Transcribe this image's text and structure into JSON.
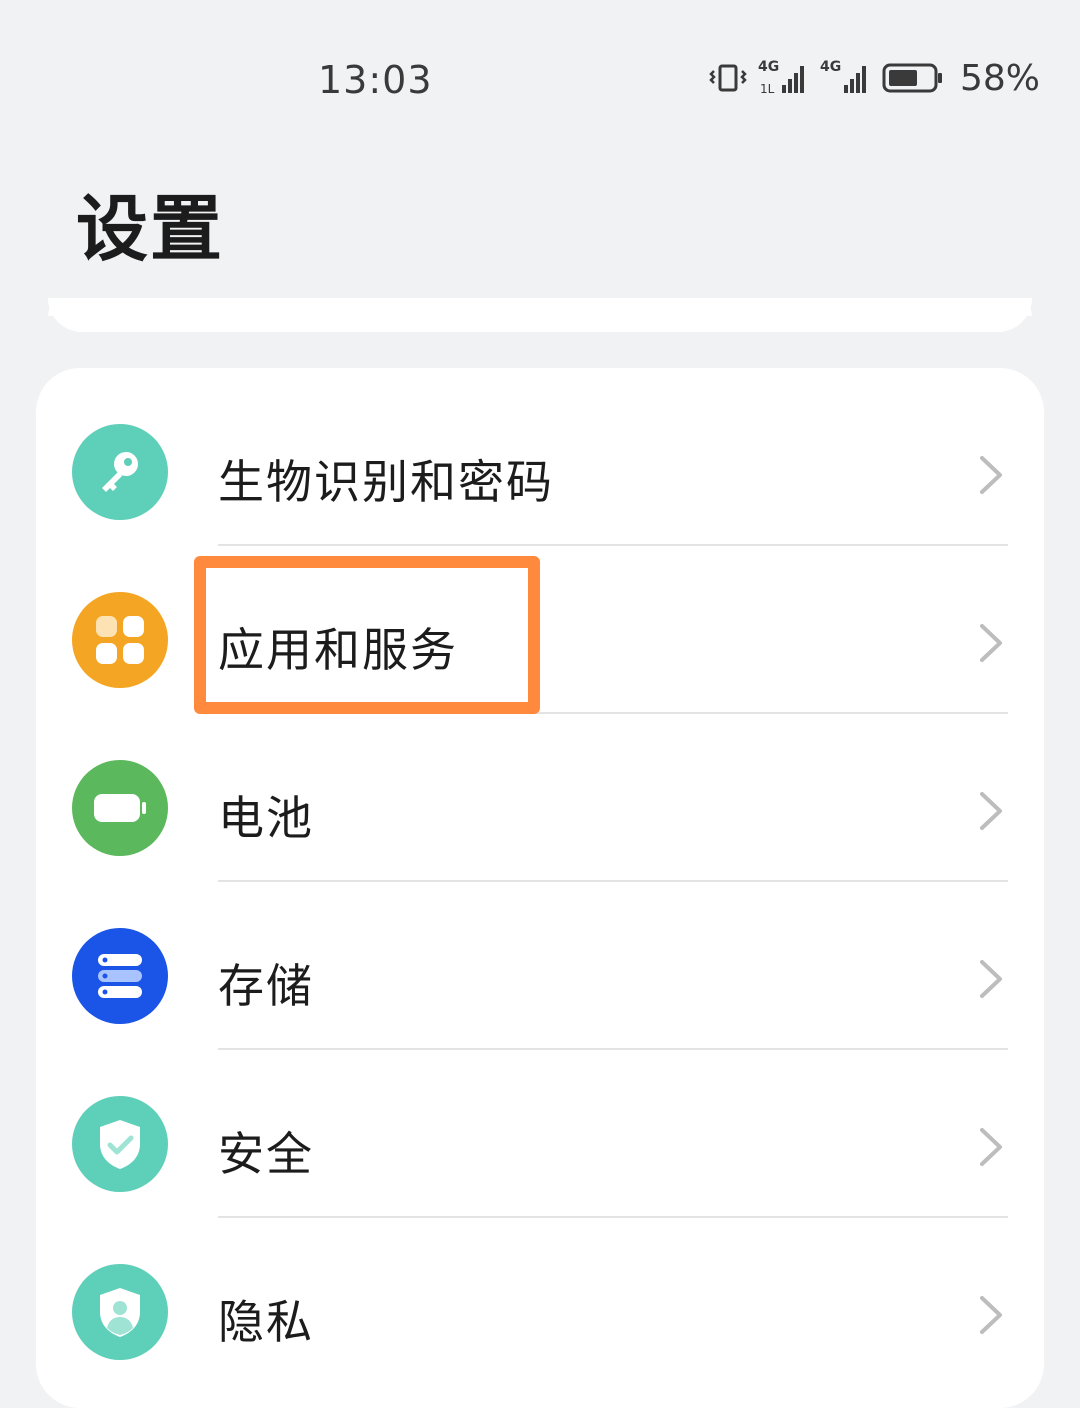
{
  "status_bar": {
    "time": "13:03",
    "battery_percent": "58%",
    "network_1": "4G",
    "network_2": "4G",
    "icons": [
      "vibrate-icon",
      "signal-4g-icon",
      "signal-4g-icon",
      "battery-icon"
    ]
  },
  "header": {
    "title": "设置"
  },
  "settings": {
    "items": [
      {
        "label": "生物识别和密码",
        "icon": "key-icon",
        "color": "#5ecfb8"
      },
      {
        "label": "应用和服务",
        "icon": "apps-grid-icon",
        "color": "#f5a524"
      },
      {
        "label": "电池",
        "icon": "battery-icon",
        "color": "#5cb85c"
      },
      {
        "label": "存储",
        "icon": "storage-icon",
        "color": "#1a55e8"
      },
      {
        "label": "安全",
        "icon": "shield-check-icon",
        "color": "#5ecfb8"
      },
      {
        "label": "隐私",
        "icon": "privacy-shield-icon",
        "color": "#5ecfb8"
      }
    ]
  },
  "highlight": {
    "color": "#ff8a3d",
    "target": "应用和服务"
  }
}
